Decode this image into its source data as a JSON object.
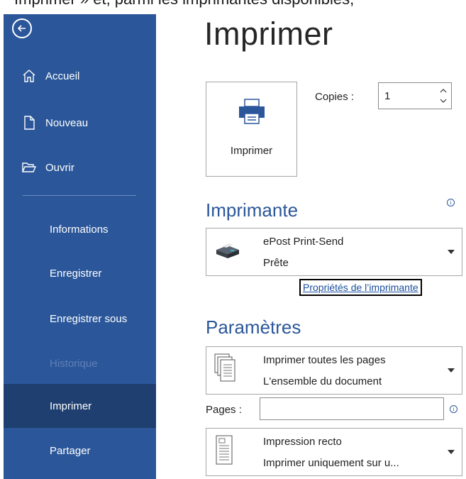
{
  "caption": "Imprimer » et, parmi les imprimantes disponibles,",
  "sidebar": {
    "back_icon": "back-arrow-icon",
    "items": [
      {
        "label": "Accueil",
        "icon": "home-icon"
      },
      {
        "label": "Nouveau",
        "icon": "new-document-icon"
      },
      {
        "label": "Ouvrir",
        "icon": "open-folder-icon"
      },
      {
        "label": "Informations"
      },
      {
        "label": "Enregistrer"
      },
      {
        "label": "Enregistrer sous"
      },
      {
        "label": "Historique",
        "state": "disabled"
      },
      {
        "label": "Imprimer",
        "state": "active"
      },
      {
        "label": "Partager"
      }
    ]
  },
  "main": {
    "title": "Imprimer",
    "print_button_label": "Imprimer",
    "copies_label": "Copies :",
    "copies_value": "1",
    "printer_section": "Imprimante",
    "printer": {
      "name": "ePost Print-Send",
      "status": "Prête"
    },
    "printer_properties_link": "Propriétés de l’imprimante",
    "settings_section": "Paramètres",
    "pages_setting": {
      "line1": "Imprimer toutes les pages",
      "line2": "L'ensemble du document"
    },
    "pages_label": "Pages :",
    "pages_value": "",
    "sides_setting": {
      "line1": "Impression recto",
      "line2": "Imprimer uniquement sur u..."
    }
  },
  "colors": {
    "sidebar": "#2b579a",
    "active": "#1e3f6f",
    "accent": "#2b579a"
  }
}
